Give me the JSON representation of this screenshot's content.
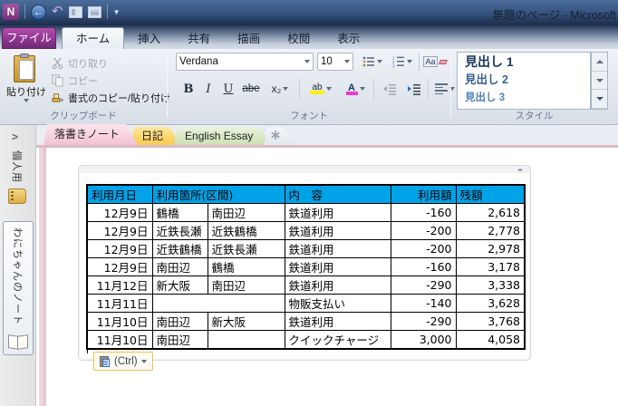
{
  "window": {
    "title": "無題のページ - Microsoft"
  },
  "qat_icons": [
    "onenote-app-icon",
    "back-icon",
    "undo-icon",
    "dock-to-desktop-icon",
    "full-page-view-icon",
    "customize-qat-dropdown"
  ],
  "ribbon": {
    "file_tab": "ファイル",
    "tabs": [
      "ホーム",
      "挿入",
      "共有",
      "描画",
      "校閲",
      "表示"
    ],
    "active_tab": "ホーム",
    "clipboard": {
      "label": "クリップボード",
      "paste": "貼り付け",
      "cut": "切り取り",
      "copy": "コピー",
      "format_painter": "書式のコピー/貼り付け"
    },
    "font": {
      "label": "フォント",
      "font_name": "Verdana",
      "font_size": "10",
      "bold": "B",
      "italic": "I",
      "underline": "U",
      "strikethrough": "abe",
      "subscript": "x₂",
      "highlight_glyph": "ab",
      "font_color_glyph": "A",
      "clear_format_glyph": "Aa"
    },
    "styles": {
      "label": "スタイル",
      "items": [
        "見出し 1",
        "見出し 2",
        "見出し 3"
      ],
      "item_colors": [
        "#17365D",
        "#366092",
        "#4F81BD"
      ],
      "item_sizes": [
        "14px",
        "12.5px",
        "11.5px"
      ]
    }
  },
  "section_tabs": [
    {
      "label": "落書きノート",
      "active": true,
      "new_section": false,
      "color_top": "#FBE6EB",
      "color_bottom": "#F2C3D1"
    },
    {
      "label": "日記",
      "active": false,
      "new_section": false,
      "color_top": "#FEE79C",
      "color_bottom": "#F8CA50"
    },
    {
      "label": "English Essay",
      "active": false,
      "new_section": false,
      "color_top": "#EAF2DE",
      "color_bottom": "#CBE1B2"
    },
    {
      "label": "",
      "active": false,
      "new_section": true,
      "color_top": "#F3F5F8",
      "color_bottom": "#E3E8EF"
    }
  ],
  "sidebar": {
    "expand_glyph": ">",
    "notebooks": [
      {
        "label": "個人用",
        "selected": false
      },
      {
        "label": "わにちゃんのノート",
        "selected": true
      }
    ]
  },
  "table": {
    "header": [
      "利用月日",
      "利用箇所(区間)",
      "内　容",
      "利用額",
      "残額"
    ],
    "header_bg": "#00A3E8",
    "rows": [
      [
        "12月9日",
        "鶴橋",
        "南田辺",
        "鉄道利用",
        "-160",
        "2,618"
      ],
      [
        "12月9日",
        "近鉄長瀬",
        "近鉄鶴橋",
        "鉄道利用",
        "-200",
        "2,778"
      ],
      [
        "12月9日",
        "近鉄鶴橋",
        "近鉄長瀬",
        "鉄道利用",
        "-200",
        "2,978"
      ],
      [
        "12月9日",
        "南田辺",
        "鶴橋",
        "鉄道利用",
        "-160",
        "3,178"
      ],
      [
        "11月12日",
        "新大阪",
        "南田辺",
        "鉄道利用",
        "-290",
        "3,338"
      ],
      [
        "11月11日",
        "",
        "",
        "物販支払い",
        "-140",
        "3,628"
      ],
      [
        "11月10日",
        "南田辺",
        "新大阪",
        "鉄道利用",
        "-290",
        "3,768"
      ],
      [
        "11月10日",
        "南田辺",
        "",
        "クイックチャージ",
        "3,000",
        "4,058"
      ]
    ]
  },
  "paste_options": {
    "label": "(Ctrl)"
  },
  "colors": {
    "table_header": "#00A3E8",
    "file_tab": "#8F3791",
    "titlebar_top": "#4A6C9B",
    "titlebar_bottom": "#1B2B47",
    "active_section": "#F2C3D1"
  }
}
